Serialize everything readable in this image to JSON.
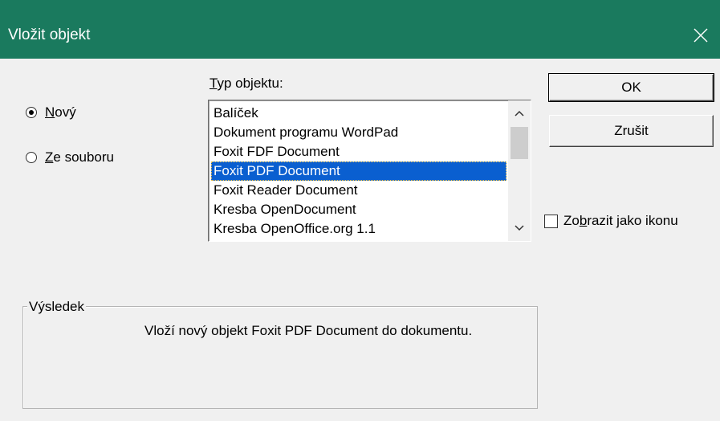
{
  "window": {
    "title": "Vložit objekt"
  },
  "source_options": [
    {
      "label": "Nový",
      "selected": true
    },
    {
      "label": "Ze souboru",
      "selected": false
    }
  ],
  "object_list": {
    "label": "Typ objektu:",
    "items": [
      "Balíček",
      "Dokument programu WordPad",
      "Foxit FDF Document",
      "Foxit PDF Document",
      "Foxit Reader Document",
      "Kresba OpenDocument",
      "Kresba OpenOffice.org 1.1"
    ],
    "selected_item": "Foxit PDF Document"
  },
  "buttons": {
    "ok_label": "OK",
    "cancel_label": "Zrušit"
  },
  "display_as_icon": {
    "label": "Zobrazit jako ikonu",
    "checked": false
  },
  "result": {
    "group_label": "Výsledek",
    "text": "Vloží nový objekt Foxit PDF Document do dokumentu."
  },
  "colors": {
    "titlebar": "#1a7a5e",
    "selection": "#0a5fd0",
    "background": "#f0f0f0"
  }
}
